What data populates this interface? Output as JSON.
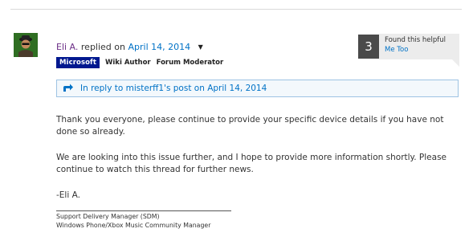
{
  "post": {
    "author": "Eli A.",
    "replied_text": "replied on",
    "date": "April 14, 2014",
    "badges": [
      "Microsoft",
      "Wiki Author",
      "Forum Moderator"
    ]
  },
  "helpful": {
    "count": "3",
    "label": "Found this helpful",
    "me_too": "Me Too"
  },
  "reply_link": "In reply to misterff1's post on April 14, 2014",
  "body": {
    "p1": "Thank you everyone, please continue to provide your specific device details if you have not done so already.",
    "p2": "We are looking into this issue further, and I hope to provide more information shortly.  Please continue to watch this thread for further news.",
    "p3": "-Eli A."
  },
  "signature": {
    "line1": "Support Delivery Manager (SDM)",
    "line2": "Windows Phone/Xbox Music Community Manager"
  },
  "icons": {
    "avatar": "avatar-image",
    "reply": "reply-arrow-icon",
    "dropdown": "chevron-down-icon"
  },
  "colors": {
    "link": "#0072c6",
    "author": "#6b2d86",
    "microsoft_badge": "#00188f",
    "count_bg": "#4a4a4a",
    "reply_bg": "#f3f8fc",
    "reply_border": "#9ec3e3"
  }
}
